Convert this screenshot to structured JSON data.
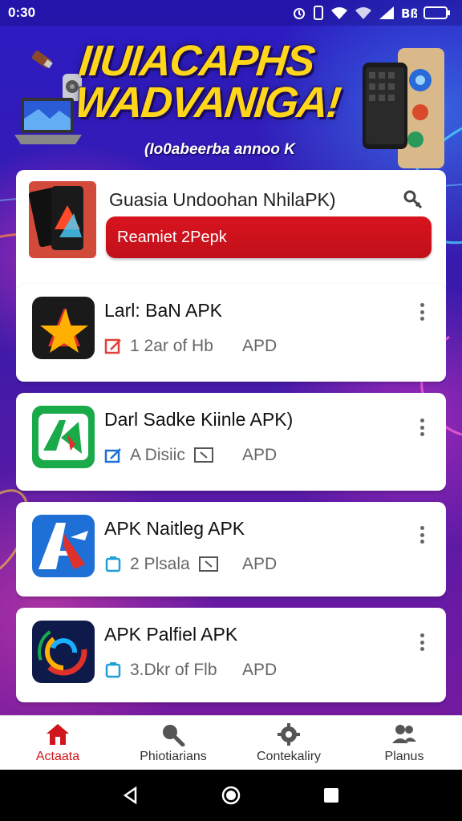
{
  "status_bar": {
    "time": "0:30"
  },
  "banner": {
    "title_line1": "IIUIACAPHS",
    "title_line2": "WADVANIGA!",
    "subtitle": "(Io0abeerba annoo K"
  },
  "featured": {
    "title": "Guasia Undoohan NhilaPK)",
    "button_label": "Reamiet 2Pepk"
  },
  "apps": [
    {
      "name": "Larl: BaN APK",
      "meta": "1 2ar of Hb",
      "tag": "APD",
      "meta_color": "#e0413a"
    },
    {
      "name": "Darl Sadke Kiinle APK)",
      "meta": "A Disiic",
      "tag": "APD",
      "meta_color": "#1e6fd6"
    },
    {
      "name": "APK Naitleg APK",
      "meta": "2 Plsala",
      "tag": "APD",
      "meta_color": "#1e9fd6"
    },
    {
      "name": "APK Palfiel APK",
      "meta": "3.Dkr of Flb",
      "tag": "APD",
      "meta_color": "#1e9fd6"
    }
  ],
  "bottom_nav": [
    {
      "label": "Actaata",
      "icon": "home-icon",
      "active": true
    },
    {
      "label": "Phiotiarians",
      "icon": "search-icon",
      "active": false
    },
    {
      "label": "Contekaliry",
      "icon": "gear-icon",
      "active": false
    },
    {
      "label": "Planus",
      "icon": "people-icon",
      "active": false
    }
  ],
  "colors": {
    "accent_red": "#d0151c",
    "banner_yellow": "#ffd61a",
    "background_blue": "#2b1cc4"
  }
}
